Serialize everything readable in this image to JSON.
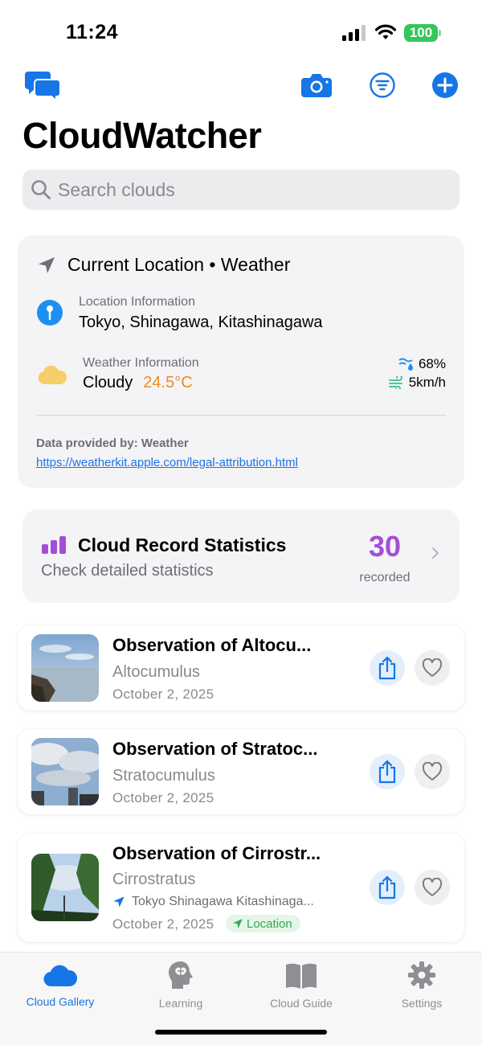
{
  "status_bar": {
    "time": "11:24",
    "battery": "100"
  },
  "header": {
    "app_title": "CloudWatcher",
    "icons": [
      "chat-bubbles-icon",
      "camera-icon",
      "filter-icon",
      "add-icon"
    ]
  },
  "search": {
    "placeholder": "Search clouds"
  },
  "weather_card": {
    "title": "Current Location • Weather",
    "location_label": "Location Information",
    "location_value": "Tokyo, Shinagawa, Kitashinagawa",
    "weather_label": "Weather Information",
    "condition": "Cloudy",
    "temperature": "24.5°C",
    "humidity": "68%",
    "wind": "5km/h",
    "attribution_label": "Data provided by:  Weather",
    "attribution_link": "https://weatherkit.apple.com/legal-attribution.html"
  },
  "stats_card": {
    "title": "Cloud Record Statistics",
    "subtitle": "Check detailed statistics",
    "count": "30",
    "count_label": "recorded"
  },
  "observations": [
    {
      "title": "Observation of Altocu...",
      "type": "Altocumulus",
      "date": "October 2, 2025"
    },
    {
      "title": "Observation of Stratoc...",
      "type": "Stratocumulus",
      "date": "October 2, 2025"
    },
    {
      "title": "Observation of Cirrostr...",
      "type": "Cirrostratus",
      "location": "Tokyo Shinagawa Kitashinaga...",
      "date": "October 2, 2025",
      "badge": "Location"
    }
  ],
  "tabs": [
    {
      "label": "Cloud Gallery",
      "icon": "cloud-icon",
      "active": true
    },
    {
      "label": "Learning",
      "icon": "brain-head-icon",
      "active": false
    },
    {
      "label": "Cloud Guide",
      "icon": "book-icon",
      "active": false
    },
    {
      "label": "Settings",
      "icon": "gear-icon",
      "active": false
    }
  ],
  "colors": {
    "accent": "#1676e6",
    "temperature": "#f08a24",
    "stats_purple": "#a44ed6",
    "location_green": "#34a853",
    "battery": "#34c759"
  }
}
